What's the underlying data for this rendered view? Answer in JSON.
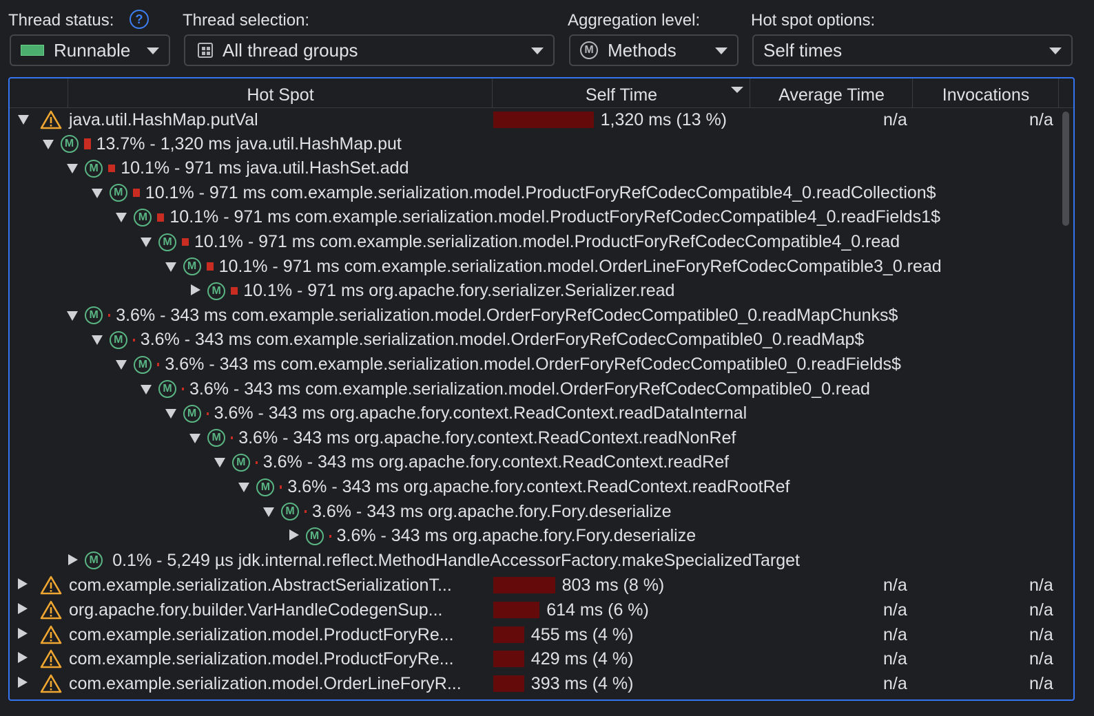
{
  "toolbar": {
    "thread_status_label": "Thread status:",
    "thread_status_value": "Runnable",
    "thread_selection_label": "Thread selection:",
    "thread_selection_value": "All thread groups",
    "aggregation_label": "Aggregation level:",
    "aggregation_value": "Methods",
    "hotspot_options_label": "Hot spot options:",
    "hotspot_options_value": "Self times",
    "help_glyph": "?"
  },
  "table": {
    "headers": {
      "hot_spot": "Hot Spot",
      "self_time": "Self Time",
      "average_time": "Average Time",
      "invocations": "Invocations"
    },
    "top_row": {
      "name": "java.util.HashMap.putVal",
      "self_time": "1,320 ms (13 %)",
      "percent": 13,
      "average": "n/a",
      "invocations": "n/a"
    },
    "tree": [
      {
        "text": "13.7% - 1,320 ms java.util.HashMap.put",
        "percent": 13.7
      },
      {
        "text": "10.1% - 971 ms java.util.HashSet.add",
        "percent": 10.1
      },
      {
        "text": "10.1% - 971 ms com.example.serialization.model.ProductForyRefCodecCompatible4_0.readCollection$",
        "percent": 10.1
      },
      {
        "text": "10.1% - 971 ms com.example.serialization.model.ProductForyRefCodecCompatible4_0.readFields1$",
        "percent": 10.1
      },
      {
        "text": "10.1% - 971 ms com.example.serialization.model.ProductForyRefCodecCompatible4_0.read",
        "percent": 10.1
      },
      {
        "text": "10.1% - 971 ms com.example.serialization.model.OrderLineForyRefCodecCompatible3_0.read",
        "percent": 10.1
      },
      {
        "text": "10.1% - 971 ms org.apache.fory.serializer.Serializer.read",
        "percent": 10.1
      },
      {
        "text": "3.6% - 343 ms com.example.serialization.model.OrderForyRefCodecCompatible0_0.readMapChunks$",
        "percent": 3.6
      },
      {
        "text": "3.6% - 343 ms com.example.serialization.model.OrderForyRefCodecCompatible0_0.readMap$",
        "percent": 3.6
      },
      {
        "text": "3.6% - 343 ms com.example.serialization.model.OrderForyRefCodecCompatible0_0.readFields$",
        "percent": 3.6
      },
      {
        "text": "3.6% - 343 ms com.example.serialization.model.OrderForyRefCodecCompatible0_0.read",
        "percent": 3.6
      },
      {
        "text": "3.6% - 343 ms org.apache.fory.context.ReadContext.readDataInternal",
        "percent": 3.6
      },
      {
        "text": "3.6% - 343 ms org.apache.fory.context.ReadContext.readNonRef",
        "percent": 3.6
      },
      {
        "text": "3.6% - 343 ms org.apache.fory.context.ReadContext.readRef",
        "percent": 3.6
      },
      {
        "text": "3.6% - 343 ms org.apache.fory.context.ReadContext.readRootRef",
        "percent": 3.6
      },
      {
        "text": "3.6% - 343 ms org.apache.fory.Fory.deserialize",
        "percent": 3.6
      },
      {
        "text": "3.6% - 343 ms org.apache.fory.Fory.deserialize",
        "percent": 3.6
      },
      {
        "text": "0.1% - 5,249 µs jdk.internal.reflect.MethodHandleAccessorFactory.makeSpecializedTarget",
        "percent": 0.1
      }
    ],
    "bottom_rows": [
      {
        "name": "com.example.serialization.AbstractSerializationT...",
        "self_time": "803 ms (8 %)",
        "percent": 8,
        "average": "n/a",
        "invocations": "n/a"
      },
      {
        "name": "org.apache.fory.builder.VarHandleCodegenSup...",
        "self_time": "614 ms (6 %)",
        "percent": 6,
        "average": "n/a",
        "invocations": "n/a"
      },
      {
        "name": "com.example.serialization.model.ProductForyRe...",
        "self_time": "455 ms (4 %)",
        "percent": 4,
        "average": "n/a",
        "invocations": "n/a"
      },
      {
        "name": "com.example.serialization.model.ProductForyRe...",
        "self_time": "429 ms (4 %)",
        "percent": 4,
        "average": "n/a",
        "invocations": "n/a"
      },
      {
        "name": "com.example.serialization.model.OrderLineForyR...",
        "self_time": "393 ms (4 %)",
        "percent": 4,
        "average": "n/a",
        "invocations": "n/a"
      }
    ]
  },
  "colors": {
    "accent": "#3574f0",
    "method_green": "#59b583",
    "bar_red": "#650a0a",
    "mini_bar": "#c92d22",
    "warning": "#f0a732"
  }
}
